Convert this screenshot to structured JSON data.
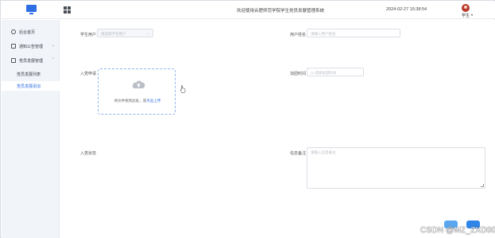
{
  "header": {
    "system_title": "欢迎使用合肥师范学院学生党员发展管理系统",
    "datetime": "2024-02-27 15:38:54",
    "user_name": "学生",
    "user_caret": "▾"
  },
  "sidebar": {
    "items": [
      {
        "label": "后台首页",
        "icon": "clock-icon"
      },
      {
        "label": "通知公告管理",
        "icon": "checkbox-icon",
        "chevron": "⌄"
      },
      {
        "label": "党员发展管理",
        "icon": "checkbox-icon",
        "chevron": "⌃"
      }
    ],
    "sub_items": [
      {
        "label": "党员发展列表",
        "active": false
      },
      {
        "label": "党员发展添加",
        "active": true
      }
    ]
  },
  "form": {
    "student_label": "学生用户",
    "student_placeholder": "请选择学生用户",
    "student_caret": "⌄",
    "user_name_label": "用户姓名",
    "user_name_placeholder": "请输入用户姓名",
    "application_label": "入党申请",
    "upload_text": "将文件拖到此处，或",
    "upload_link": "点击上传",
    "join_time_label": "加团时间",
    "join_time_placeholder": "选择加团时间",
    "status_label": "入党状态",
    "notes_label": "信息备注",
    "notes_placeholder": "请输入信息备注"
  },
  "colors": {
    "accent": "#2f6fe4",
    "button_light": "#5aa7f0",
    "button_dark": "#2f85e8",
    "sidebar_bg": "#f1f4f8"
  },
  "watermark": "CSDN @MZ_ZXD001"
}
